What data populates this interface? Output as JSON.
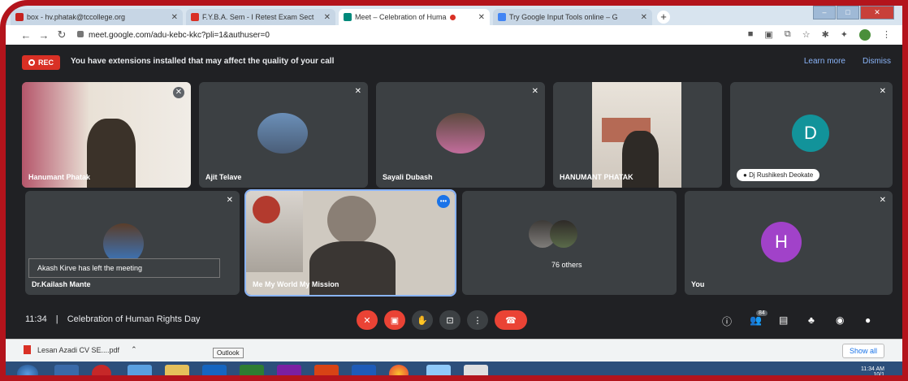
{
  "browser": {
    "tabs": [
      {
        "label": "box - hv.phatak@tccollege.org",
        "color": "#c5221f"
      },
      {
        "label": "F.Y.B.A. Sem - I Retest Exam Sect",
        "color": "#d93025"
      },
      {
        "label": "Meet – Celebration of Huma",
        "color": "#00897b"
      },
      {
        "label": "Try Google Input Tools online – G",
        "color": "#4285f4"
      }
    ],
    "url": "meet.google.com/adu-kebc-kkc?pli=1&authuser=0"
  },
  "banner": {
    "rec_label": "REC",
    "message": "You have extensions installed that may affect the quality of your call",
    "learn_more": "Learn more",
    "dismiss": "Dismiss"
  },
  "tiles": {
    "t1": {
      "name": "Hanumant Phatak"
    },
    "t2": {
      "name": "Ajit Telave"
    },
    "t3": {
      "name": "Sayali Dubash"
    },
    "t4": {
      "name": "HANUMANT PHATAK"
    },
    "t5": {
      "name": "Dj Rushikesh Deokate",
      "letter": "D",
      "color": "#12939a"
    },
    "t6": {
      "name": "Dr.Kailash Mante",
      "toast": "Akash Kirve has left the meeting"
    },
    "t7": {
      "name": "Me My World My Mission"
    },
    "t8": {
      "name": "76 others"
    },
    "t9": {
      "name": "You",
      "letter": "H",
      "color": "#a142c9"
    }
  },
  "bottom": {
    "time": "11:34",
    "separator": "|",
    "title": "Celebration of Human Rights Day",
    "participants_count": "84"
  },
  "downloads": {
    "item": "Lesan Azadi CV SE....pdf",
    "show_all": "Show all"
  },
  "taskbar": {
    "tooltip": "Outlook",
    "clock_time": "11:34 AM",
    "clock_date": "10/1"
  }
}
